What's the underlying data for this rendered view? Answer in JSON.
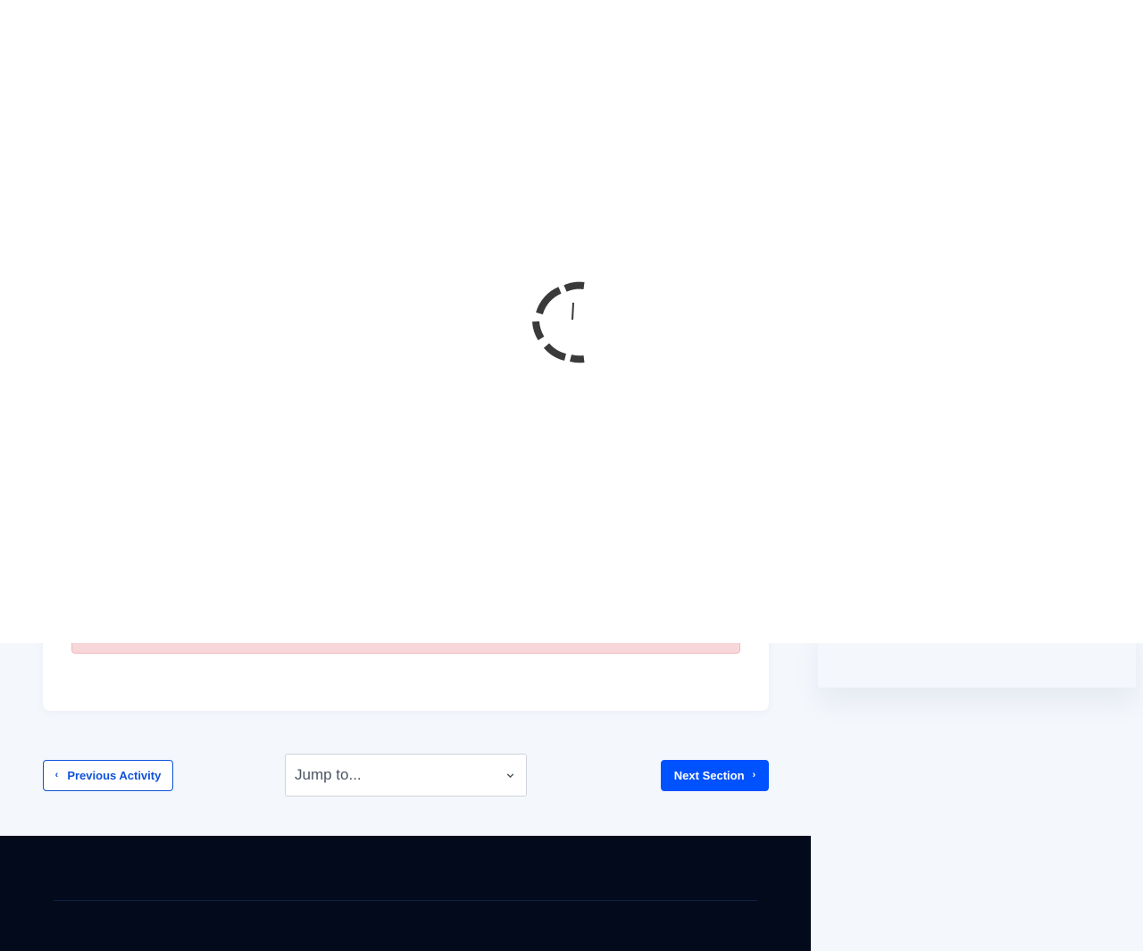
{
  "navigation": {
    "prev_label": "Previous Activity",
    "next_label": "Next Section",
    "jump_placeholder": "Jump to..."
  },
  "colors": {
    "primary": "#0052ff",
    "footer_bg": "#020a1c",
    "page_bg": "#f4f7fc",
    "alert_bg": "#f8d7da",
    "spinner": "#3a3a3a"
  },
  "icons": {
    "spinner": "loading-spinner-icon",
    "prev": "chevron-left-icon",
    "next": "chevron-right-icon",
    "select": "chevron-down-icon"
  }
}
